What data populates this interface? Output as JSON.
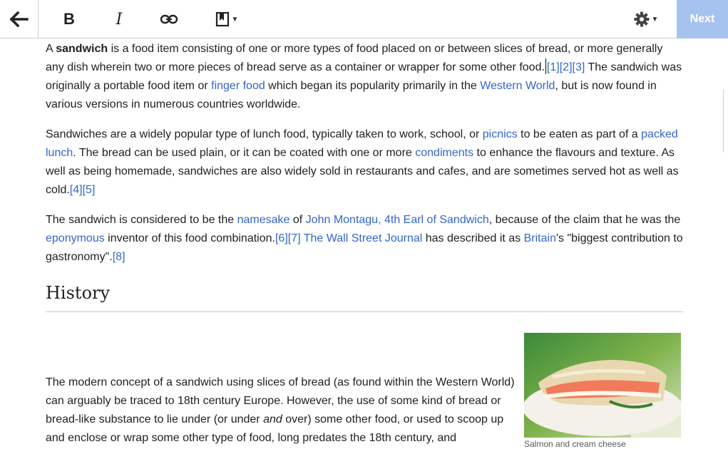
{
  "toolbar": {
    "back_icon": "arrow-left-icon",
    "bold_label": "B",
    "italic_label": "I",
    "link_icon": "link-icon",
    "cite_icon": "bookmark-icon",
    "settings_icon": "gear-icon",
    "next_label": "Next",
    "next_color": "#a6c3f0"
  },
  "article": {
    "p1": {
      "t1": "A ",
      "bold": "sandwich",
      "t2": " is a food item consisting of one or more types of food placed on or between slices of bread, or more generally any dish wherein two or more pieces of bread serve as a container or wrapper for some other food.",
      "ref1": "[1]",
      "ref2": "[2]",
      "ref3": "[3]",
      "t3": " The sandwich was originally a portable food item or ",
      "link1": "finger food",
      "t4": " which began its popularity primarily in the ",
      "link2": "Western World",
      "t5": ", but is now found in various versions in numerous countries worldwide."
    },
    "p2": {
      "t1": "Sandwiches are a widely popular type of lunch food, typically taken to work, school, or ",
      "link1": "picnics",
      "t2": " to be eaten as part of a ",
      "link2": "packed lunch",
      "t3": ". The bread can be used plain, or it can be coated with one or more ",
      "link3": "condiments",
      "t4": " to enhance the flavours and texture. As well as being homemade, sandwiches are also widely sold in restaurants and cafes, and are sometimes served hot as well as cold.",
      "ref1": "[4]",
      "ref2": "[5]"
    },
    "p3": {
      "t1": "The sandwich is considered to be the ",
      "link1": "namesake",
      "t2": " of ",
      "link2": "John Montagu, 4th Earl of Sandwich",
      "t3": ", because of the claim that he was the ",
      "link3": "eponymous",
      "t4": " inventor of this food combination.",
      "ref1": "[6]",
      "ref2": "[7]",
      "link4": " The Wall Street Journal",
      "t5": " has described it as ",
      "link5": "Britain",
      "t6": "'s \"biggest contribution to gastronomy\".",
      "ref3": "[8]"
    },
    "heading": "History",
    "p4": {
      "t1": "The modern concept of a sandwich using slices of bread (as found within the Western World) can arguably be traced to 18th century Europe. However, the use of some kind of bread or bread-like substance to lie under (or under ",
      "italic": "and",
      "t2": " over) some other food, or used to scoop up and enclose or wrap some other type of food, long predates the 18th century, and"
    },
    "image_caption": "Salmon and cream cheese",
    "link_color": "#3366cc"
  }
}
